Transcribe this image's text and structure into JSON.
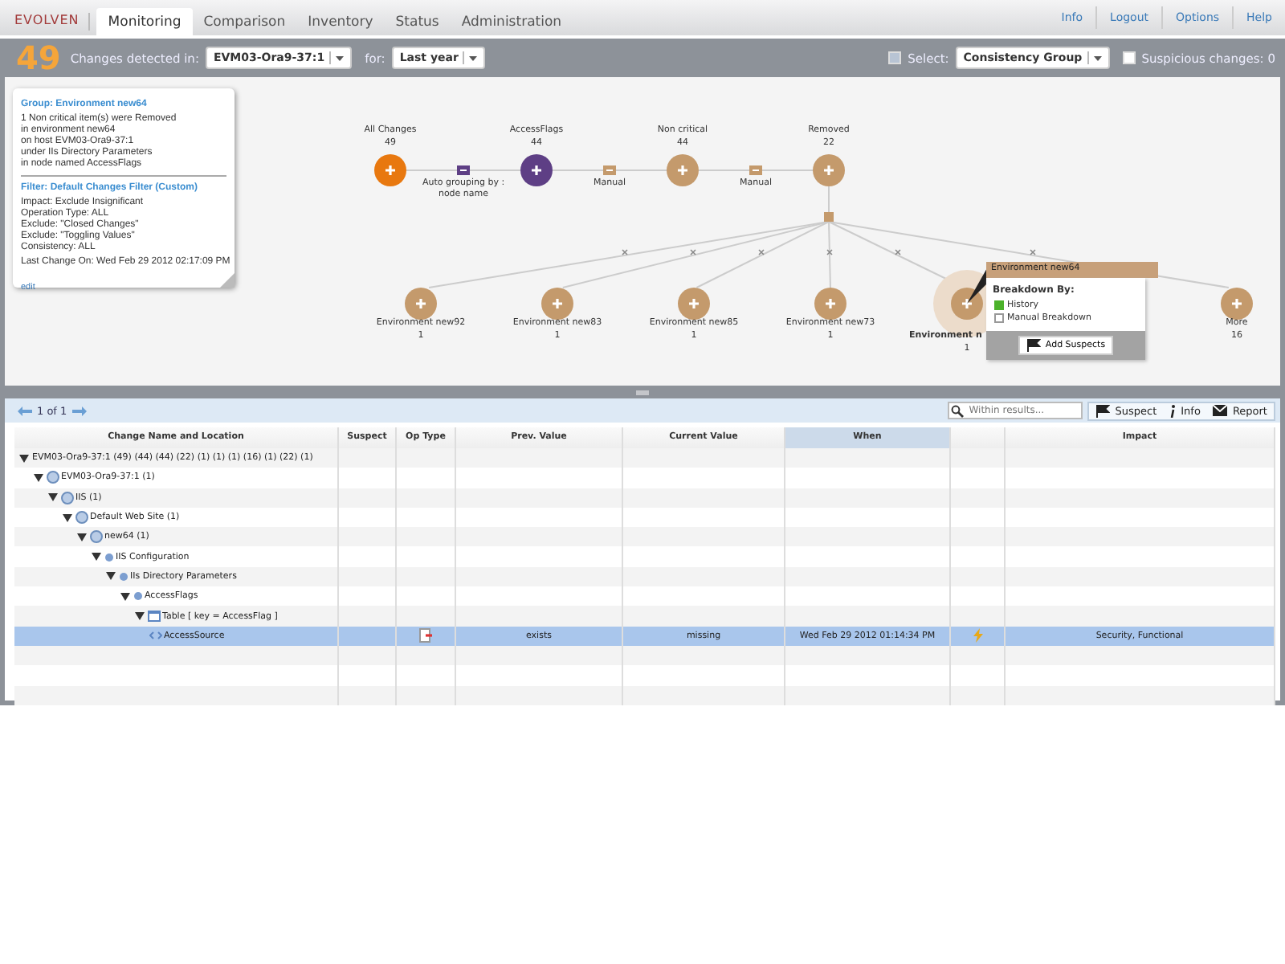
{
  "header": {
    "logo": "EVOLVEN",
    "tabs": [
      {
        "label": "Monitoring",
        "selected": true
      },
      {
        "label": "Comparison",
        "selected": false
      },
      {
        "label": "Inventory",
        "selected": false
      },
      {
        "label": "Status",
        "selected": false
      },
      {
        "label": "Administration",
        "selected": false
      }
    ],
    "links": [
      "Info",
      "Logout",
      "Options",
      "Help"
    ]
  },
  "toolbar": {
    "count": "49",
    "changes_label": "Changes detected in:",
    "host": "EVM03-Ora9-37:1",
    "for_label": "for:",
    "period": "Last year",
    "select_label": "Select:",
    "select_checked": false,
    "group": "Consistency Group",
    "suspicious": {
      "label": "Suspicious changes: 0",
      "checked": false
    }
  },
  "summary": {
    "group_title": "Group: Environment new64",
    "group_lines": [
      "1 Non critical item(s) were Removed",
      "in environment new64",
      "on host EVM03-Ora9-37:1",
      "under IIs Directory Parameters",
      "in node named AccessFlags"
    ],
    "filter_title": "Filter: Default Changes Filter (Custom)",
    "filter_lines": [
      "Impact: Exclude Insignificant",
      "Operation Type: ALL",
      "Exclude: \"Closed Changes\"",
      "Exclude: \"Toggling Values\"",
      "Consistency: ALL"
    ],
    "last_change": "Last Change On: Wed Feb 29 2012 02:17:09 PM",
    "edit": "edit"
  },
  "graph": {
    "top_nodes": [
      {
        "label": "All Changes",
        "count": "49",
        "color": "#e8780f"
      },
      {
        "label": "AccessFlags",
        "count": "44",
        "color": "#5e3f85"
      },
      {
        "label": "Non critical",
        "count": "44",
        "color": "#c49a6c"
      },
      {
        "label": "Removed",
        "count": "22",
        "color": "#c49a6c"
      }
    ],
    "connectors": [
      {
        "label": "Auto grouping by : node name",
        "color": "#5e3f85"
      },
      {
        "label": "Manual",
        "color": "#c49a6c"
      },
      {
        "label": "Manual",
        "color": "#c49a6c"
      }
    ],
    "bottom_nodes": [
      {
        "label": "Environment new92",
        "count": "1",
        "selected": false
      },
      {
        "label": "Environment new83",
        "count": "1",
        "selected": false
      },
      {
        "label": "Environment new85",
        "count": "1",
        "selected": false
      },
      {
        "label": "Environment new73",
        "count": "1",
        "selected": false
      },
      {
        "label": "Environment n",
        "count": "1",
        "selected": true
      },
      {
        "label": "More",
        "count": "16",
        "selected": false
      }
    ],
    "popup": {
      "title": "Environment new64",
      "heading": "Breakdown By:",
      "options": [
        {
          "label": "History",
          "checked": true
        },
        {
          "label": "Manual Breakdown",
          "checked": false
        }
      ],
      "button": "Add Suspects"
    }
  },
  "results": {
    "pager": "1 of 1",
    "search": {
      "placeholder": "Within results..."
    },
    "buttons": [
      "Suspect",
      "Info",
      "Report"
    ],
    "columns": [
      {
        "label": "Change Name and Location",
        "sorted": false
      },
      {
        "label": "Suspect",
        "sorted": false
      },
      {
        "label": "Op Type",
        "sorted": false
      },
      {
        "label": "Prev. Value",
        "sorted": false
      },
      {
        "label": "Current Value",
        "sorted": false
      },
      {
        "label": "When",
        "sorted": true
      },
      {
        "sorted": false
      },
      {
        "label": "Impact",
        "sorted": false
      }
    ],
    "tree": [
      {
        "label": "EVM03-Ora9-37:1 (49) (44) (44) (22) (1) (1) (1) (16) (1) (22) (1)",
        "expanded": true,
        "selected": false,
        "children": [
          {
            "label": "EVM03-Ora9-37:1 (1)",
            "kind": "globe",
            "expanded": true,
            "selected": false,
            "children": [
              {
                "label": "IIS (1)",
                "kind": "globe",
                "expanded": true,
                "selected": false,
                "children": [
                  {
                    "label": "Default Web Site (1)",
                    "kind": "globe",
                    "expanded": true,
                    "selected": false,
                    "children": [
                      {
                        "label": "new64 (1)",
                        "kind": "globe",
                        "expanded": true,
                        "selected": false,
                        "children": [
                          {
                            "label": "IIS Configuration",
                            "kind": "dot",
                            "expanded": true,
                            "selected": false,
                            "children": [
                              {
                                "label": "IIs Directory Parameters",
                                "kind": "dot",
                                "expanded": true,
                                "selected": false,
                                "children": [
                                  {
                                    "label": "AccessFlags",
                                    "kind": "dot",
                                    "expanded": true,
                                    "selected": false,
                                    "children": [
                                      {
                                        "label": "Table [ key = AccessFlag ]",
                                        "kind": "table",
                                        "expanded": true,
                                        "selected": false,
                                        "children": [
                                          {
                                            "label": "AccessSource",
                                            "kind": "key",
                                            "selected": true,
                                            "removed": true,
                                            "prev": "exists",
                                            "current": "missing",
                                            "when": "Wed Feb 29 2012 01:14:34 PM",
                                            "alert": true,
                                            "impact": "Security, Functional"
                                          }
                                        ]
                                      }
                                    ]
                                  }
                                ]
                              }
                            ]
                          }
                        ]
                      }
                    ]
                  }
                ]
              }
            ]
          }
        ]
      }
    ]
  }
}
